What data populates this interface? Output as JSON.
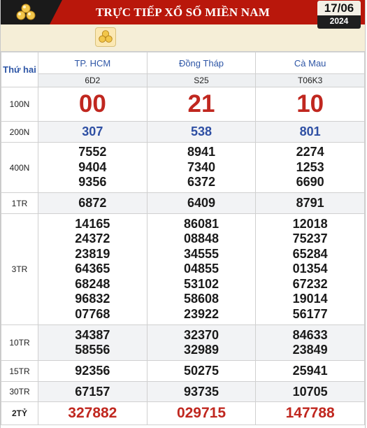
{
  "header": {
    "title": "TRỰC TIẾP XỔ SỐ MIỀN NAM",
    "date_day": "17/06",
    "date_year": "2024",
    "logo_icon": "coins-icon"
  },
  "colors": {
    "brand": "#b9170b",
    "prize_red": "#c0271f",
    "prize_blue": "#2e4fa3",
    "province": "#2e56a6"
  },
  "table": {
    "day_label": "Thứ hai",
    "provinces": [
      {
        "name": "TP. HCM",
        "code": "6D2"
      },
      {
        "name": "Đồng Tháp",
        "code": "S25"
      },
      {
        "name": "Cà Mau",
        "code": "T06K3"
      }
    ],
    "prizes": {
      "p100n": {
        "label": "100N",
        "values": [
          "00",
          "21",
          "10"
        ]
      },
      "p200n": {
        "label": "200N",
        "values": [
          "307",
          "538",
          "801"
        ]
      },
      "p400n": {
        "label": "400N",
        "values": [
          [
            "7552",
            "9404",
            "9356"
          ],
          [
            "8941",
            "7340",
            "6372"
          ],
          [
            "2274",
            "1253",
            "6690"
          ]
        ]
      },
      "p1tr": {
        "label": "1TR",
        "values": [
          "6872",
          "6409",
          "8791"
        ]
      },
      "p3tr": {
        "label": "3TR",
        "values": [
          [
            "14165",
            "24372",
            "23819",
            "64365",
            "68248",
            "96832",
            "07768"
          ],
          [
            "86081",
            "08848",
            "34555",
            "04855",
            "53102",
            "58608",
            "23922"
          ],
          [
            "12018",
            "75237",
            "65284",
            "01354",
            "67232",
            "19014",
            "56177"
          ]
        ]
      },
      "p10tr": {
        "label": "10TR",
        "values": [
          [
            "34387",
            "58556"
          ],
          [
            "32370",
            "32989"
          ],
          [
            "84633",
            "23849"
          ]
        ]
      },
      "p15tr": {
        "label": "15TR",
        "values": [
          "92356",
          "50275",
          "25941"
        ]
      },
      "p30tr": {
        "label": "30TR",
        "values": [
          "67157",
          "93735",
          "10705"
        ]
      },
      "p2ty": {
        "label": "2TỶ",
        "values": [
          "327882",
          "029715",
          "147788"
        ]
      }
    }
  }
}
